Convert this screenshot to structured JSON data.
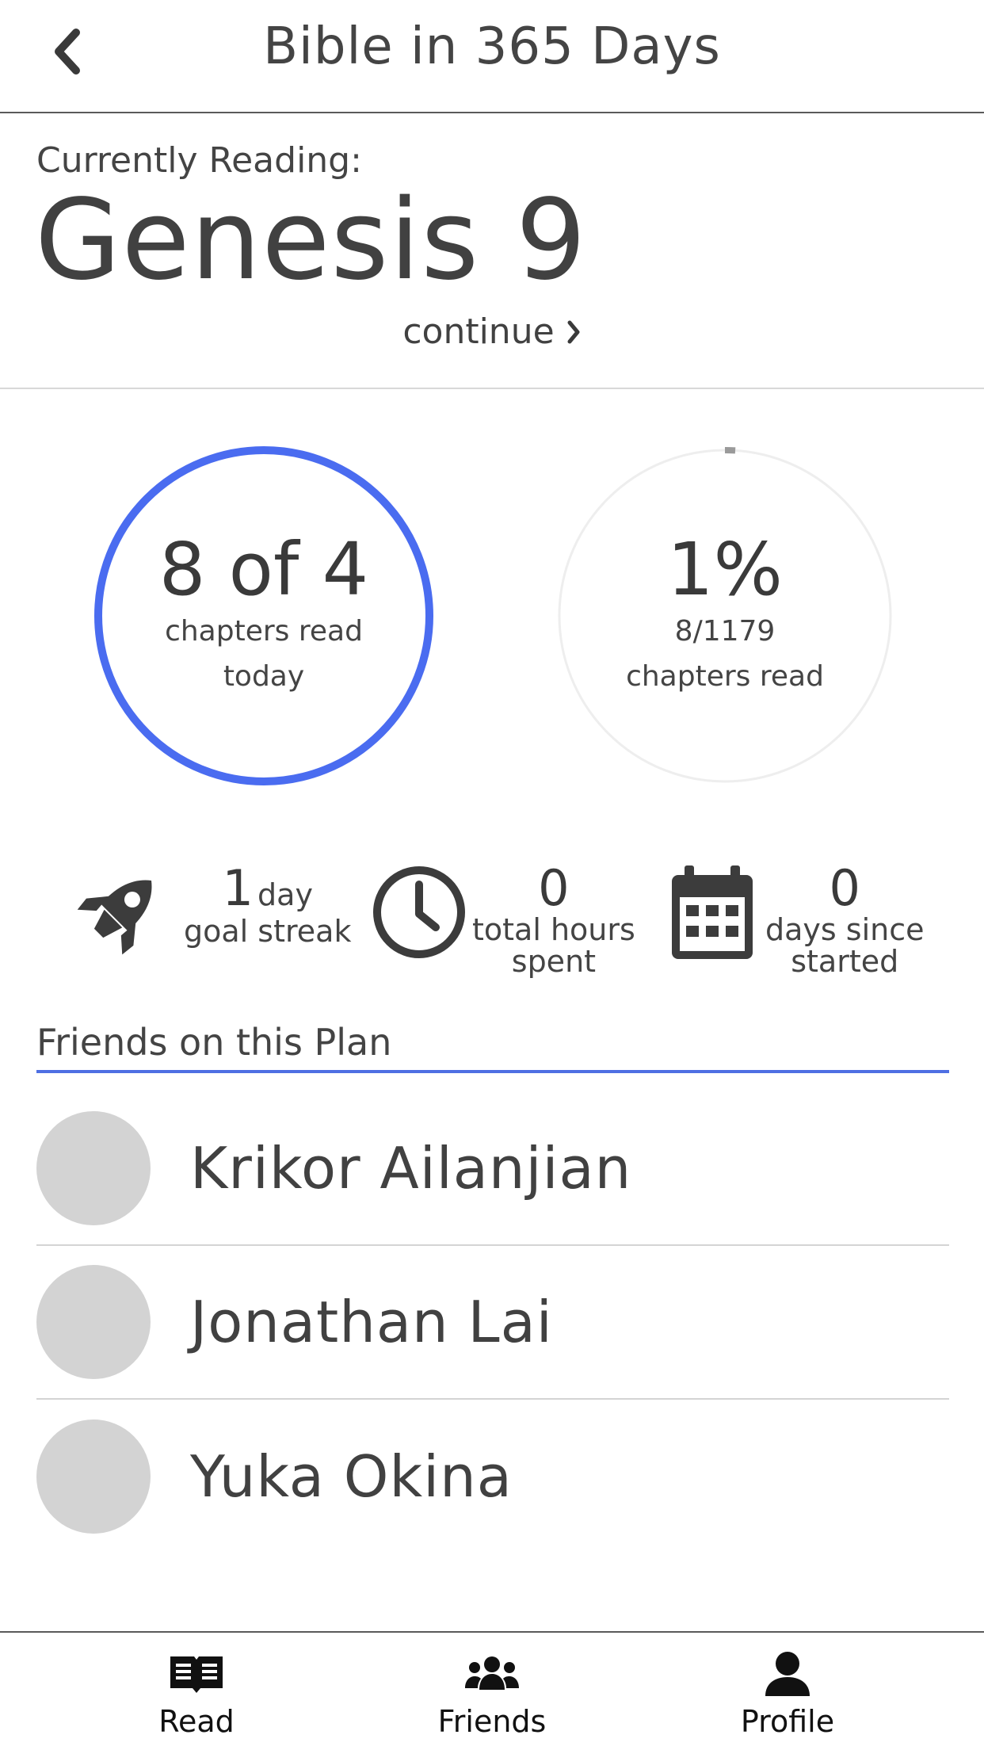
{
  "header": {
    "title": "Bible in 365 Days",
    "back_icon": "chevron-left-icon"
  },
  "reading": {
    "label": "Currently Reading:",
    "book": "Genesis 9",
    "continue_label": "continue",
    "continue_icon": "chevron-right-icon"
  },
  "daily_progress": {
    "big": "8 of 4",
    "line1": "chapters read",
    "line2": "today",
    "ring_fraction": 1.0,
    "ring_color": "#4a6cf0"
  },
  "overall_progress": {
    "big": "1%",
    "line1": "8/1179",
    "line2": "chapters read",
    "ring_fraction": 0.01,
    "ring_color": "#9a9a9a",
    "track_color": "#eeeeee"
  },
  "stats": {
    "streak": {
      "icon": "rocket-icon",
      "value": "1",
      "unit": "day",
      "label": "goal streak"
    },
    "hours": {
      "icon": "clock-icon",
      "value": "0",
      "label1": "total hours",
      "label2": "spent"
    },
    "days": {
      "icon": "calendar-icon",
      "value": "0",
      "label1": "days since",
      "label2": "started"
    }
  },
  "friends": {
    "heading": "Friends on this Plan",
    "accent": "#4e6fe3",
    "list": [
      {
        "name": "Krikor Ailanjian"
      },
      {
        "name": "Jonathan Lai"
      },
      {
        "name": "Yuka Okina"
      }
    ]
  },
  "nav": {
    "items": [
      {
        "label": "Read",
        "icon": "book-icon"
      },
      {
        "label": "Friends",
        "icon": "users-icon"
      },
      {
        "label": "Profile",
        "icon": "user-icon"
      }
    ]
  }
}
